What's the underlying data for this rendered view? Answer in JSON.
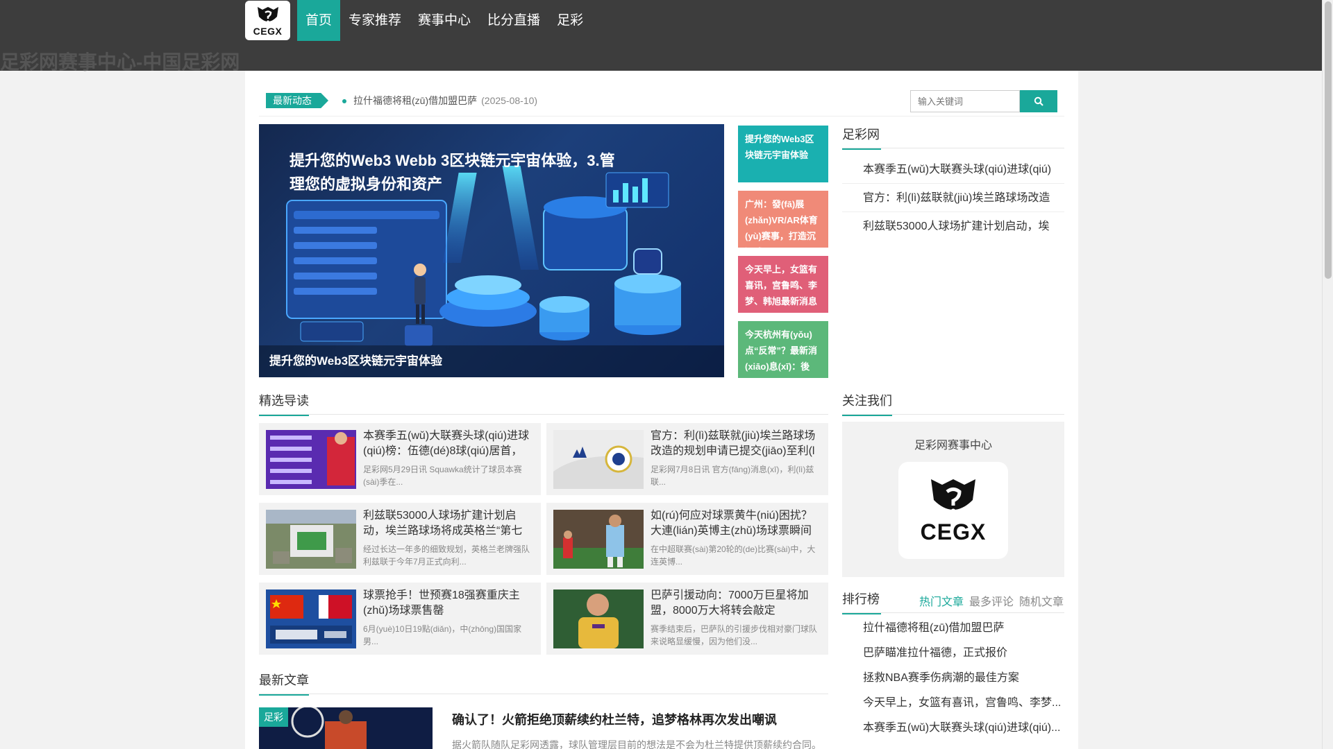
{
  "header": {
    "logo_text": "CEGX",
    "nav": [
      "首页",
      "专家推荐",
      "赛事中心",
      "比分直播",
      "足彩"
    ],
    "active_index": 0,
    "site_title": "足彩网赛事中心-中国足彩网"
  },
  "ticker": {
    "label": "最新动态",
    "item": "拉什福德将租(zū)借加盟巴萨",
    "date": "(2025-08-10)"
  },
  "search": {
    "placeholder": "输入关键词",
    "icon": "search-icon"
  },
  "hero": {
    "headline": "提升您的Web3 Webb 3区块链元宇宙体验，3.管理您的虚拟身份和资产",
    "caption": "提升您的Web3区块链元宇宙体验"
  },
  "side_cards": [
    {
      "text": "提升您的Web3区块链元宇宙体验",
      "color": "#1ab0b0"
    },
    {
      "text": "广州：發(fā)展(zhǎn)VR/AR体育(yù)赛事，打造沉浸式",
      "color": "#f08a78"
    },
    {
      "text": "今天早上，女篮有喜讯，宫鲁鸣、李梦、韩旭最新消息",
      "color": "#e05f78"
    },
    {
      "text": "今天杭州有(yǒu)点“反常”？最新消(xiāo)息(xī)：後(hò",
      "color": "#5cb87a"
    }
  ],
  "right_widget": {
    "title": "足彩网",
    "items": [
      "本赛季五(wǔ)大联赛头球(qiú)进球(qiú)",
      "官方：利(lì)兹联就(jiù)埃兰路球场改造",
      "利兹联53000人球场扩建计划启动，埃"
    ]
  },
  "featured": {
    "title": "精选导读",
    "items": [
      {
        "title": "本赛季五(wǔ)大联赛头球(qiú)进球(qiú)榜：伍德(dé)8球(qiú)居首，",
        "excerpt": "足彩网5月29日讯 Squawka统计了球员本赛(sài)季在..."
      },
      {
        "title": "官方：利(lì)兹联就(jiù)埃兰路球场改造的规划申请已提交(jiāo)至利(l",
        "excerpt": "足彩网7月8日讯 官方(fāng)消息(xī)，利(lì)兹联..."
      },
      {
        "title": "利兹联53000人球场扩建计划启动，埃兰路球场将成英格兰“第七",
        "excerpt": "经过长达一年多的细致规划，英格兰老牌强队利兹联于今年7月正式向利..."
      },
      {
        "title": "如(rú)何应对球票黄牛(niú)困扰？大連(lián)英博主(zhǔ)场球票瞬间",
        "excerpt": "在中超联赛(sài)第20轮的(de)比赛(sài)中，大连英博..."
      },
      {
        "title": "球票抢手！世预赛18强赛重庆主(zhǔ)场球票售罄",
        "excerpt": "6月(yuè)10日19點(diǎn)，中(zhōng)国国家男..."
      },
      {
        "title": "巴萨引援动向：7000万巨星将加盟，8000万大将转会敲定",
        "excerpt": "赛季结束后，巴萨队的引援步伐相对豪门球队来说略显缓慢，因为他们没..."
      }
    ]
  },
  "follow": {
    "title": "关注我们",
    "name": "足彩网赛事中心",
    "qr_text": "CEGX"
  },
  "ranking": {
    "title": "排行榜",
    "tabs": [
      "热门文章",
      "最多评论",
      "随机文章"
    ],
    "active_tab": 0,
    "items": [
      "拉什福德将租(zū)借加盟巴萨",
      "巴萨瞄准拉什福德，正式报价",
      "拯救NBA赛季伤病潮的最佳方案",
      "今天早上，女篮有喜讯，宫鲁鸣、李梦...",
      "本赛季五(wǔ)大联赛头球(qiú)进球(qiú)..."
    ]
  },
  "latest": {
    "title": "最新文章",
    "tag": "足彩",
    "article_title": "确认了！火箭拒绝顶薪续约杜兰特，追梦格林再次发出嘲讽",
    "article_excerpt": "据火箭队随队足彩网透露，球队管理层目前的想法是不会为杜兰特提供顶薪续约合同。"
  }
}
